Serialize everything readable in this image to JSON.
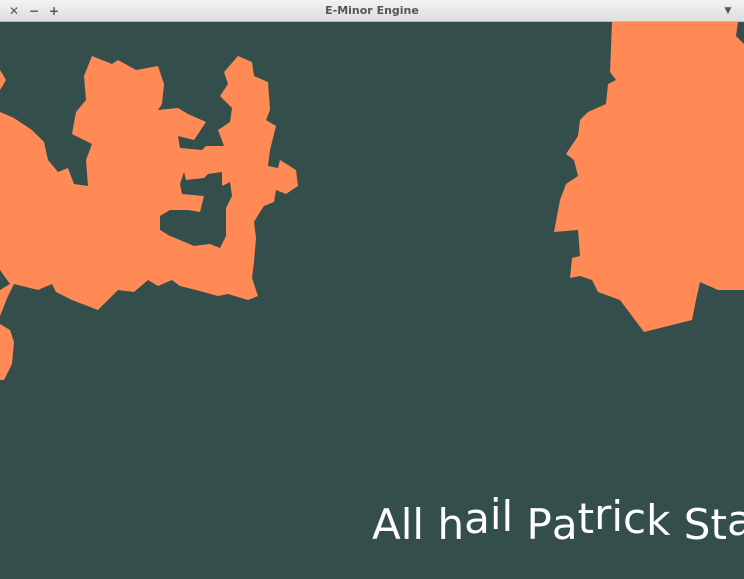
{
  "window": {
    "title": "E-Minor Engine",
    "buttons": {
      "close": "✕",
      "minimize": "−",
      "maximize": "+",
      "menu": "▼"
    }
  },
  "scene": {
    "background_color": "#344e4c",
    "terrain_color": "#ff8a55"
  },
  "hud": {
    "text": "All hail Patrick Star"
  }
}
